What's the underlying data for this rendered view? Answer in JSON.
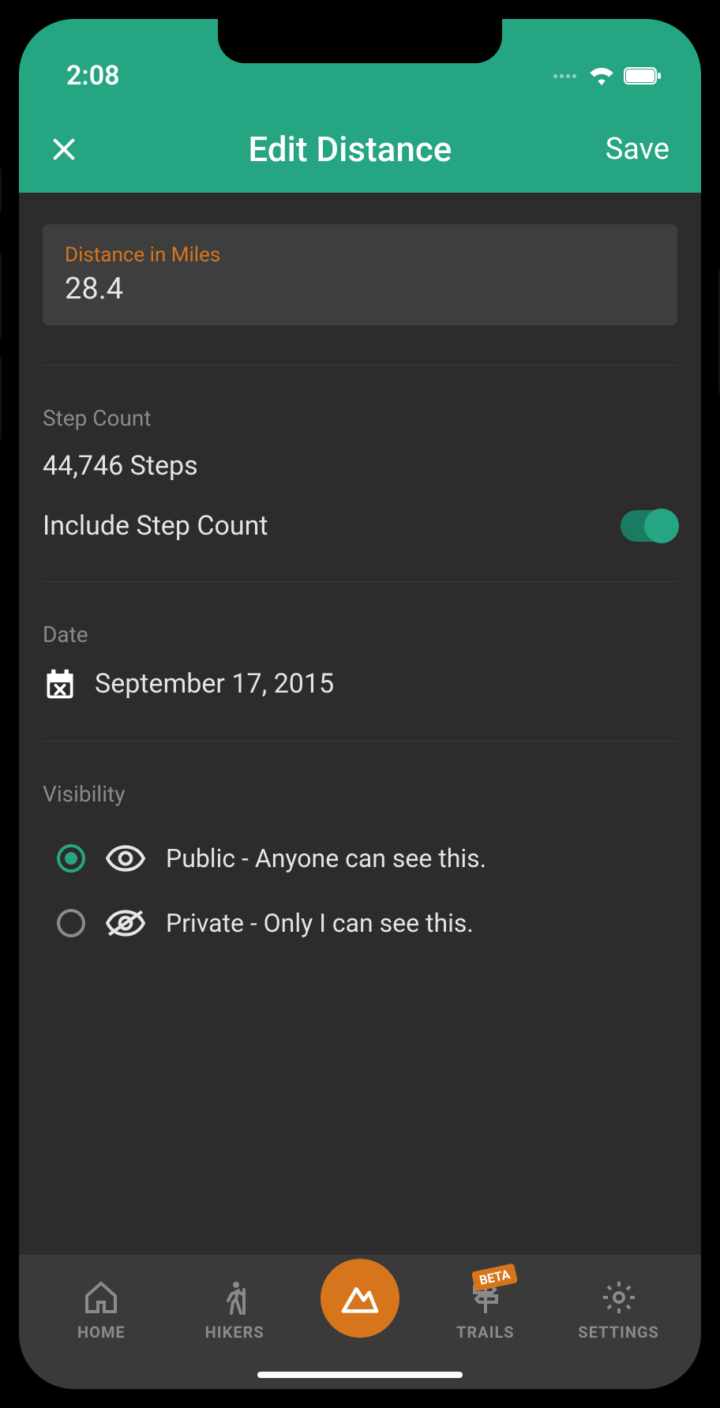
{
  "status": {
    "time": "2:08"
  },
  "header": {
    "title": "Edit Distance",
    "save_label": "Save"
  },
  "distance": {
    "label": "Distance in Miles",
    "value": "28.4"
  },
  "steps": {
    "label": "Step Count",
    "value": "44,746 Steps",
    "include_label": "Include Step Count",
    "include_on": true
  },
  "date": {
    "label": "Date",
    "value": "September 17, 2015"
  },
  "visibility": {
    "label": "Visibility",
    "options": [
      {
        "label": "Public - Anyone can see this.",
        "selected": true
      },
      {
        "label": "Private - Only I can see this.",
        "selected": false
      }
    ]
  },
  "nav": {
    "home": "HOME",
    "hikers": "HIKERS",
    "trails": "TRAILS",
    "settings": "SETTINGS",
    "beta": "BETA"
  }
}
